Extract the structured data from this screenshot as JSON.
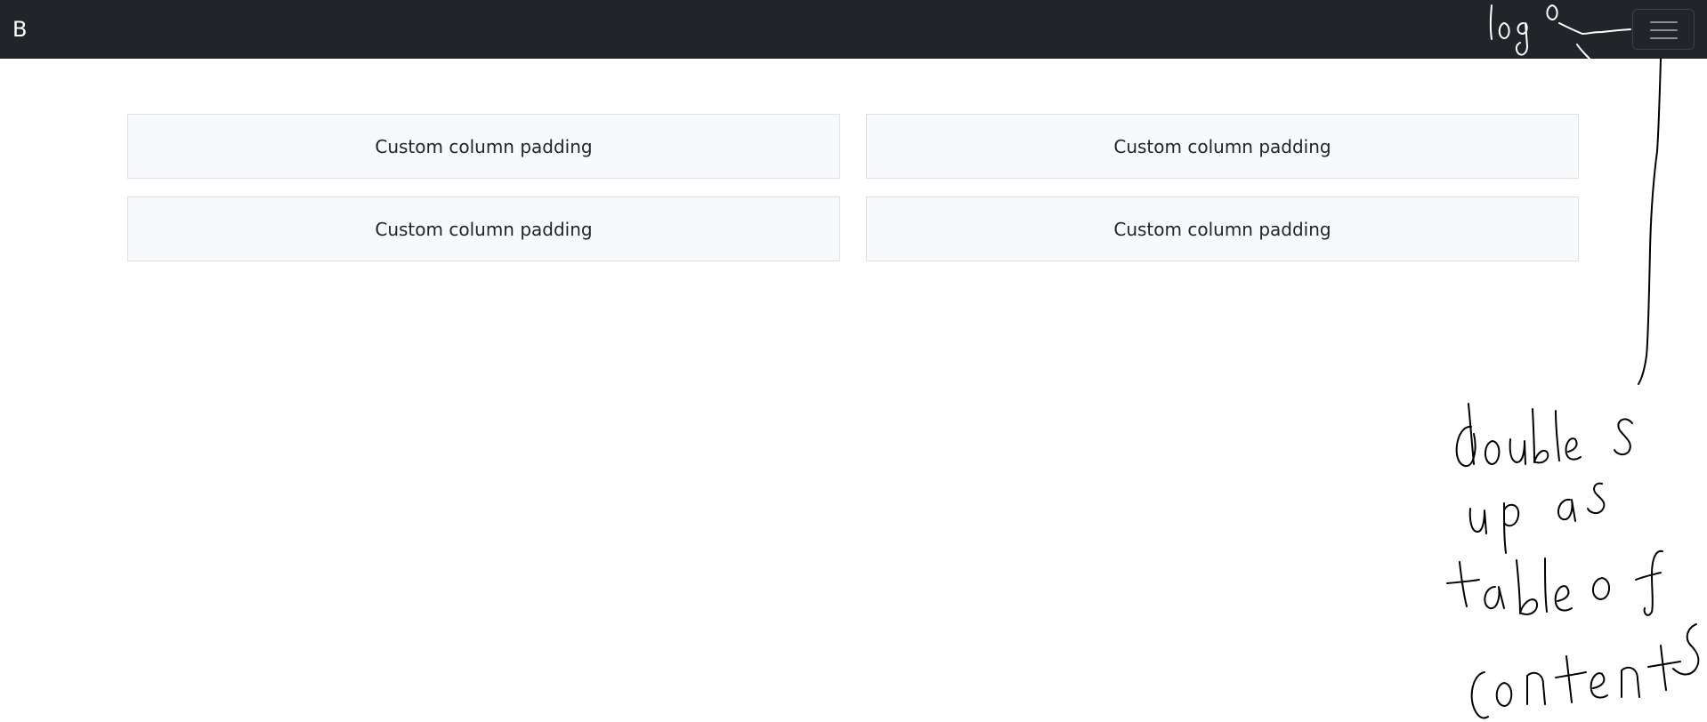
{
  "navbar": {
    "brand": "B",
    "toggler_icon": "hamburger-menu-icon"
  },
  "grid": {
    "cells": [
      "Custom column padding",
      "Custom column padding",
      "Custom column padding",
      "Custom column padding"
    ]
  },
  "annotations": {
    "logo_note": "logo",
    "menu_note": "doubles up as table of contents"
  },
  "colors": {
    "navbar_bg": "#212529",
    "cell_bg": "#f8f9fa",
    "cell_border": "#dee2e6"
  }
}
